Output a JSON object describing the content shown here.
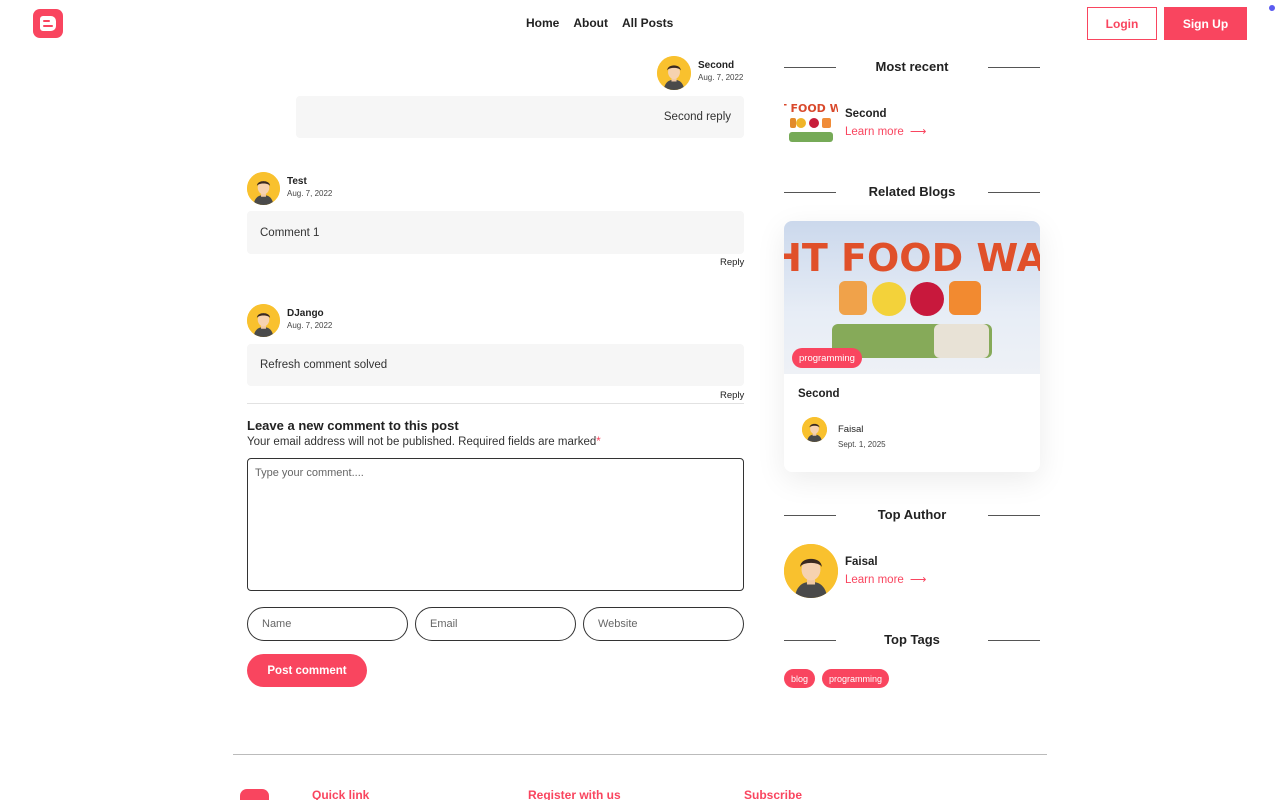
{
  "nav": {
    "links": [
      "Home",
      "About",
      "All Posts"
    ],
    "login_label": "Login",
    "signup_label": "Sign Up"
  },
  "comments": [
    {
      "author": "Second",
      "date": "Aug. 7, 2022",
      "text": "Second reply",
      "is_reply": true
    },
    {
      "author": "Test",
      "date": "Aug. 7, 2022",
      "text": "Comment 1",
      "reply_label": "Reply"
    },
    {
      "author": "DJango",
      "date": "Aug. 7, 2022",
      "text": "Refresh comment solved",
      "reply_label": "Reply"
    }
  ],
  "new_comment": {
    "title": "Leave a new comment to this post",
    "note": "Your email address will not be published. Required fields are marked",
    "required_mark": "*",
    "textarea_placeholder": "Type your comment....",
    "name_placeholder": "Name",
    "email_placeholder": "Email",
    "website_placeholder": "Website",
    "submit_label": "Post comment"
  },
  "sidebar": {
    "most_recent": {
      "title": "Most recent",
      "item": {
        "name": "Second",
        "link": "Learn more",
        "image_text": "FIGHT FOOD WASTE"
      }
    },
    "related": {
      "title": "Related Blogs",
      "card": {
        "tag": "programming",
        "title": "Second",
        "author": "Faisal",
        "date": "Sept. 1, 2025",
        "image_text": "FIGHT FOOD WASTE"
      }
    },
    "top_author": {
      "title": "Top Author",
      "name": "Faisal",
      "link": "Learn more"
    },
    "top_tags": {
      "title": "Top Tags",
      "tags": [
        "blog",
        "programming"
      ]
    }
  },
  "footer": {
    "columns": [
      "Quick link",
      "Register with us",
      "Subscribe"
    ]
  },
  "colors": {
    "accent": "#f9455f",
    "avatar_bg": "#f9c12e"
  }
}
